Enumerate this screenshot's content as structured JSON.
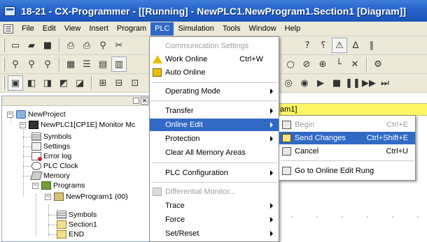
{
  "window": {
    "title": "18-21 - CX-Programmer - [[Running] - NewPLC1.NewProgram1.Section1 [Diagram]]"
  },
  "menubar": {
    "items": [
      "File",
      "Edit",
      "View",
      "Insert",
      "Program",
      "PLC",
      "Simulation",
      "Tools",
      "Window",
      "Help"
    ],
    "active": "PLC"
  },
  "tree": {
    "nodes": [
      {
        "label": "NewProject",
        "icon": "project-icon"
      },
      {
        "label": "NewPLC1[CP1E] Monitor Mc",
        "icon": "plc-icon"
      },
      {
        "label": "Symbols",
        "icon": "symbols-icon"
      },
      {
        "label": "Settings",
        "icon": "settings-icon"
      },
      {
        "label": "Error log",
        "icon": "error-log-icon"
      },
      {
        "label": "PLC Clock",
        "icon": "clock-icon"
      },
      {
        "label": "Memory",
        "icon": "memory-icon"
      },
      {
        "label": "Programs",
        "icon": "programs-icon"
      },
      {
        "label": "NewProgram1 (00)",
        "icon": "program-icon"
      },
      {
        "label": "Symbols",
        "icon": "symbols-icon"
      },
      {
        "label": "Section1",
        "icon": "section-icon"
      },
      {
        "label": "END",
        "icon": "end-section-icon"
      }
    ]
  },
  "rung": {
    "header_text": "am1]"
  },
  "plc_menu": {
    "items": [
      {
        "label": "Communication Settings",
        "disabled": true
      },
      {
        "label": "Work Online",
        "shortcut": "Ctrl+W",
        "icon": "warning-icon"
      },
      {
        "label": "Auto Online",
        "icon": "auto-online-icon"
      },
      {
        "label": "Operating Mode",
        "submenu": true
      },
      {
        "label": "Transfer",
        "submenu": true
      },
      {
        "label": "Online Edit",
        "submenu": true,
        "highlighted": true
      },
      {
        "label": "Protection",
        "submenu": true
      },
      {
        "label": "Clear All Memory Areas"
      },
      {
        "label": "PLC Configuration",
        "submenu": true
      },
      {
        "label": "Differential Monitor...",
        "disabled": true,
        "icon": "differential-monitor-icon"
      },
      {
        "label": "Trace",
        "submenu": true
      },
      {
        "label": "Force",
        "submenu": true
      },
      {
        "label": "Set/Reset",
        "submenu": true
      }
    ]
  },
  "online_edit_submenu": {
    "items": [
      {
        "label": "Begin",
        "shortcut": "Ctrl+E",
        "disabled": true
      },
      {
        "label": "Send Changes",
        "shortcut": "Ctrl+Shift+E",
        "highlighted": true
      },
      {
        "label": "Cancel",
        "shortcut": "Ctrl+U"
      },
      {
        "label": "Go to Online Edit Rung"
      }
    ]
  },
  "colors": {
    "titlebar": "#2563c9",
    "menu_highlight": "#316ac5",
    "rung_header": "#fff566",
    "chrome": "#ece9d8"
  }
}
